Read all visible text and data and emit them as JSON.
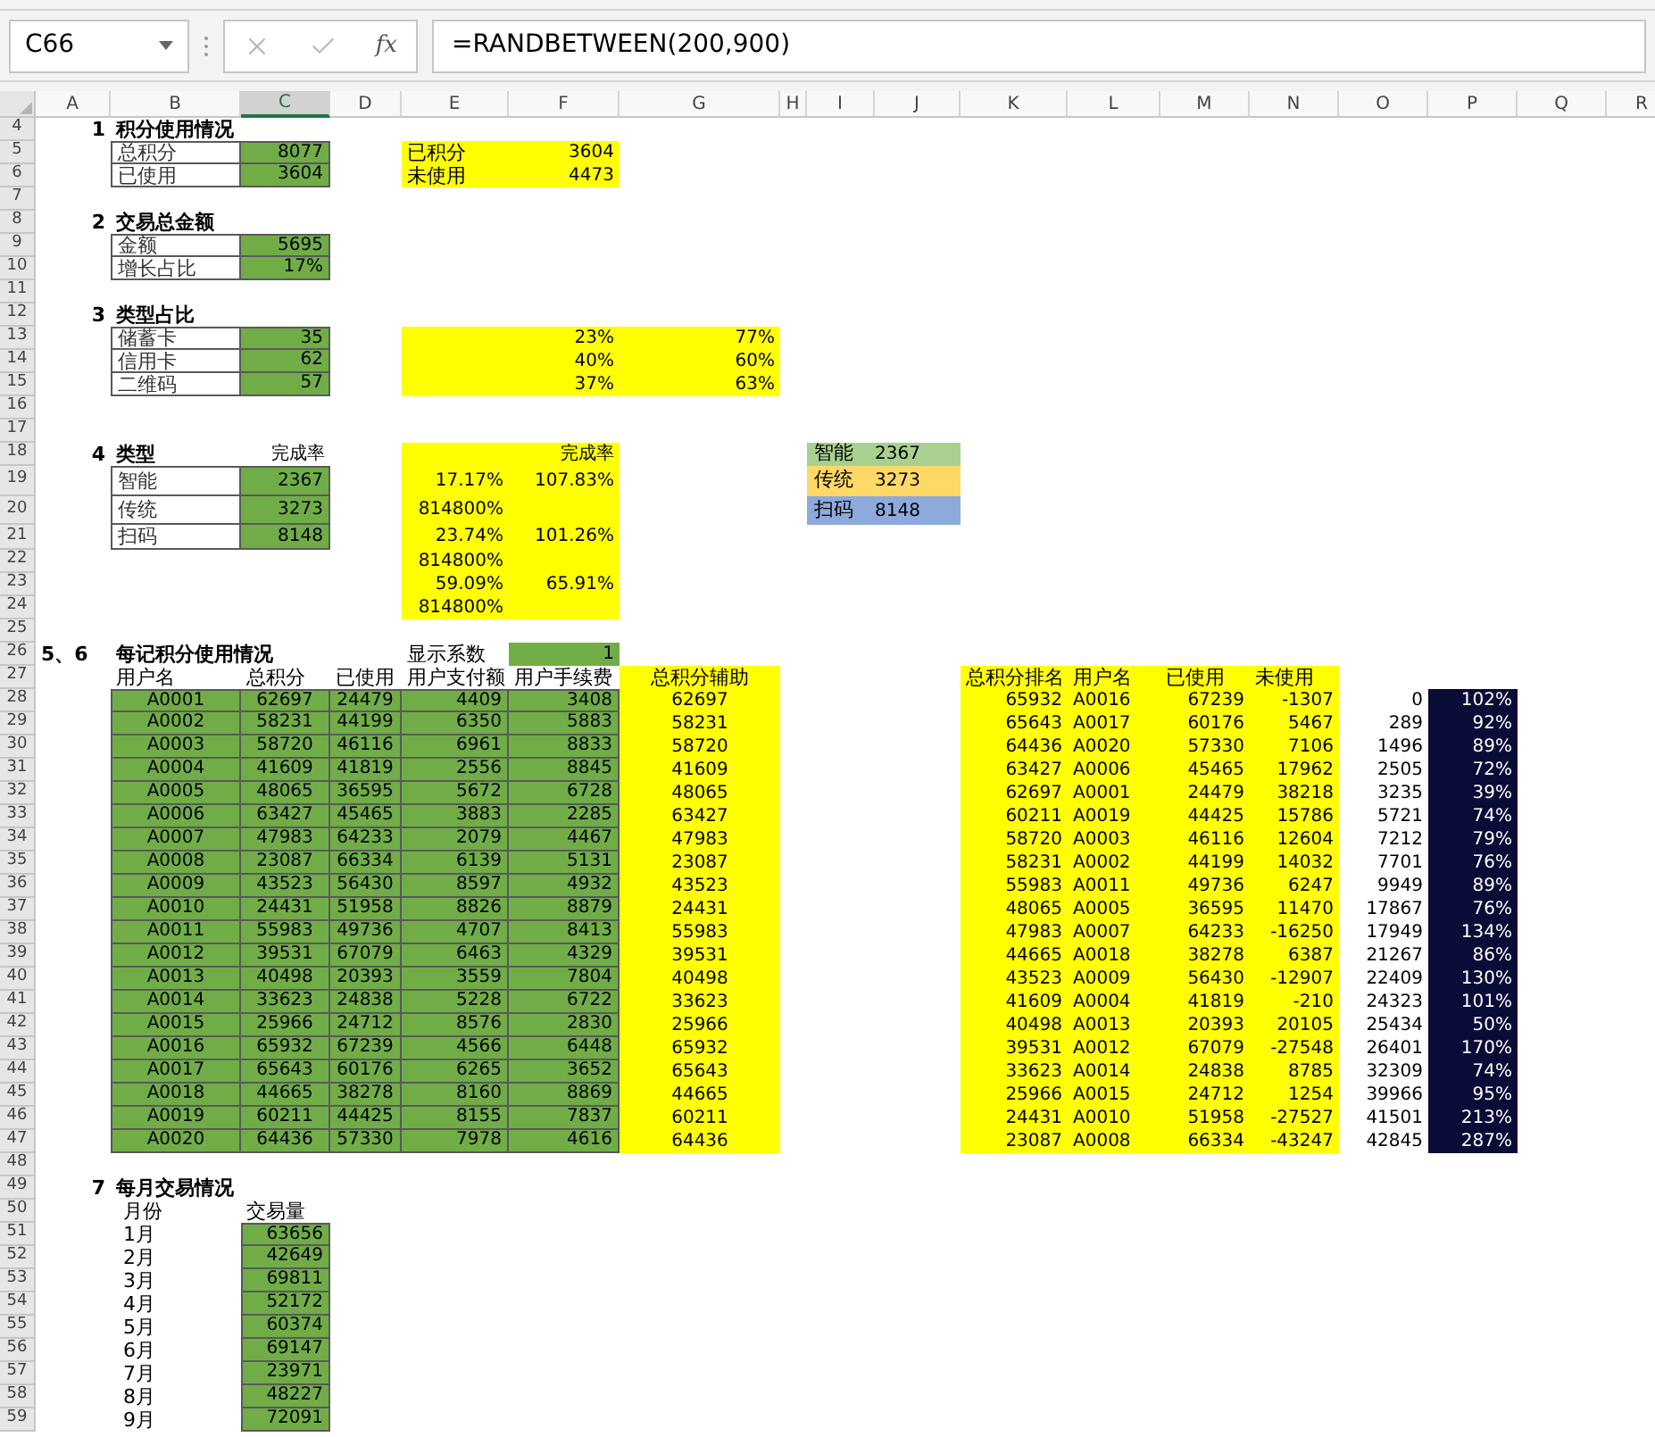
{
  "name_box": {
    "value": "C66"
  },
  "formula_bar": {
    "function_label": "fx",
    "formula": "=RANDBETWEEN(200,900)"
  },
  "columns": [
    {
      "label": "A",
      "selected": false
    },
    {
      "label": "B",
      "selected": false
    },
    {
      "label": "C",
      "selected": true
    },
    {
      "label": "D",
      "selected": false
    },
    {
      "label": "E",
      "selected": false
    },
    {
      "label": "F",
      "selected": false
    },
    {
      "label": "G",
      "selected": false
    },
    {
      "label": "H",
      "selected": false
    },
    {
      "label": "I",
      "selected": false
    },
    {
      "label": "J",
      "selected": false
    },
    {
      "label": "K",
      "selected": false
    },
    {
      "label": "L",
      "selected": false
    },
    {
      "label": "M",
      "selected": false
    },
    {
      "label": "N",
      "selected": false
    },
    {
      "label": "O",
      "selected": false
    },
    {
      "label": "P",
      "selected": false
    },
    {
      "label": "Q",
      "selected": false
    },
    {
      "label": "R",
      "selected": false
    }
  ],
  "rows": [
    "4",
    "5",
    "6",
    "7",
    "8",
    "9",
    "10",
    "11",
    "12",
    "13",
    "14",
    "15",
    "16",
    "17",
    "18",
    "19",
    "20",
    "21",
    "22",
    "23",
    "24",
    "25",
    "26",
    "27",
    "28",
    "29",
    "30",
    "31",
    "32",
    "33",
    "34",
    "35",
    "36",
    "37",
    "38",
    "39",
    "40",
    "41",
    "42",
    "43",
    "44",
    "45",
    "46",
    "47",
    "48",
    "49",
    "50",
    "51",
    "52",
    "53",
    "54",
    "55",
    "56",
    "57",
    "58",
    "59"
  ],
  "usage": {
    "number": "1",
    "title": "积分使用情况",
    "table": [
      {
        "label": "总积分",
        "value": "8077"
      },
      {
        "label": "已使用",
        "value": "3604"
      }
    ],
    "summary": [
      {
        "label": "已积分",
        "value": "3604"
      },
      {
        "label": "未使用",
        "value": "4473"
      }
    ]
  },
  "transactions": {
    "number": "2",
    "title": "交易总金额",
    "table": [
      {
        "label": "金额",
        "value": "5695"
      },
      {
        "label": "增长占比",
        "value": "17%"
      }
    ]
  },
  "type_share": {
    "number": "3",
    "title": "类型占比",
    "table": [
      {
        "label": "储蓄卡",
        "value": "35"
      },
      {
        "label": "信用卡",
        "value": "62"
      },
      {
        "label": "二维码",
        "value": "57"
      }
    ],
    "summary": [
      {
        "share": "23%",
        "rest": "77%"
      },
      {
        "share": "40%",
        "rest": "60%"
      },
      {
        "share": "37%",
        "rest": "63%"
      }
    ]
  },
  "type_completion": {
    "number": "4",
    "title": "类型",
    "value_header": "完成率",
    "table": [
      {
        "label": "智能",
        "value": "2367"
      },
      {
        "label": "传统",
        "value": "3273"
      },
      {
        "label": "扫码",
        "value": "8148"
      }
    ],
    "summary_header": "完成率",
    "summary": [
      {
        "share": "17.17%",
        "rate": "107.83%"
      },
      {
        "share": "814800%"
      },
      {
        "share": "23.74%",
        "rate": "101.26%"
      },
      {
        "share": "814800%"
      },
      {
        "share": "59.09%",
        "rate": "65.91%"
      },
      {
        "share": "814800%"
      }
    ],
    "legend": [
      {
        "label": "智能",
        "value": "2367",
        "color": "#a9d08e"
      },
      {
        "label": "传统",
        "value": "3273",
        "color": "#ffd966"
      },
      {
        "label": "扫码",
        "value": "8148",
        "color": "#8ea9db"
      }
    ]
  },
  "per_user": {
    "number": "5、6",
    "title": "每记积分使用情况",
    "coefficient_label": "显示系数",
    "coefficient": "1",
    "columns": [
      "用户名",
      "总积分",
      "已使用",
      "用户支付额",
      "用户手续费",
      "总积分辅助"
    ],
    "rows": [
      [
        "A0001",
        "62697",
        "24479",
        "4409",
        "3408",
        "62697"
      ],
      [
        "A0002",
        "58231",
        "44199",
        "6350",
        "5883",
        "58231"
      ],
      [
        "A0003",
        "58720",
        "46116",
        "6961",
        "8833",
        "58720"
      ],
      [
        "A0004",
        "41609",
        "41819",
        "2556",
        "8845",
        "41609"
      ],
      [
        "A0005",
        "48065",
        "36595",
        "5672",
        "6728",
        "48065"
      ],
      [
        "A0006",
        "63427",
        "45465",
        "3883",
        "2285",
        "63427"
      ],
      [
        "A0007",
        "47983",
        "64233",
        "2079",
        "4467",
        "47983"
      ],
      [
        "A0008",
        "23087",
        "66334",
        "6139",
        "5131",
        "23087"
      ],
      [
        "A0009",
        "43523",
        "56430",
        "8597",
        "4932",
        "43523"
      ],
      [
        "A0010",
        "24431",
        "51958",
        "8826",
        "8879",
        "24431"
      ],
      [
        "A0011",
        "55983",
        "49736",
        "4707",
        "8413",
        "55983"
      ],
      [
        "A0012",
        "39531",
        "67079",
        "6463",
        "4329",
        "39531"
      ],
      [
        "A0013",
        "40498",
        "20393",
        "3559",
        "7804",
        "40498"
      ],
      [
        "A0014",
        "33623",
        "24838",
        "5228",
        "6722",
        "33623"
      ],
      [
        "A0015",
        "25966",
        "24712",
        "8576",
        "2830",
        "25966"
      ],
      [
        "A0016",
        "65932",
        "67239",
        "4566",
        "6448",
        "65932"
      ],
      [
        "A0017",
        "65643",
        "60176",
        "6265",
        "3652",
        "65643"
      ],
      [
        "A0018",
        "44665",
        "38278",
        "8160",
        "8869",
        "44665"
      ],
      [
        "A0019",
        "60211",
        "44425",
        "8155",
        "7837",
        "60211"
      ],
      [
        "A0020",
        "64436",
        "57330",
        "7978",
        "4616",
        "64436"
      ]
    ]
  },
  "ranking": {
    "columns": [
      "总积分排名",
      "用户名",
      "已使用",
      "未使用"
    ],
    "rows": [
      [
        "65932",
        "A0016",
        "67239",
        "-1307",
        "0",
        "102%"
      ],
      [
        "65643",
        "A0017",
        "60176",
        "5467",
        "289",
        "92%"
      ],
      [
        "64436",
        "A0020",
        "57330",
        "7106",
        "1496",
        "89%"
      ],
      [
        "63427",
        "A0006",
        "45465",
        "17962",
        "2505",
        "72%"
      ],
      [
        "62697",
        "A0001",
        "24479",
        "38218",
        "3235",
        "39%"
      ],
      [
        "60211",
        "A0019",
        "44425",
        "15786",
        "5721",
        "74%"
      ],
      [
        "58720",
        "A0003",
        "46116",
        "12604",
        "7212",
        "79%"
      ],
      [
        "58231",
        "A0002",
        "44199",
        "14032",
        "7701",
        "76%"
      ],
      [
        "55983",
        "A0011",
        "49736",
        "6247",
        "9949",
        "89%"
      ],
      [
        "48065",
        "A0005",
        "36595",
        "11470",
        "17867",
        "76%"
      ],
      [
        "47983",
        "A0007",
        "64233",
        "-16250",
        "17949",
        "134%"
      ],
      [
        "44665",
        "A0018",
        "38278",
        "6387",
        "21267",
        "86%"
      ],
      [
        "43523",
        "A0009",
        "56430",
        "-12907",
        "22409",
        "130%"
      ],
      [
        "41609",
        "A0004",
        "41819",
        "-210",
        "24323",
        "101%"
      ],
      [
        "40498",
        "A0013",
        "20393",
        "20105",
        "25434",
        "50%"
      ],
      [
        "39531",
        "A0012",
        "67079",
        "-27548",
        "26401",
        "170%"
      ],
      [
        "33623",
        "A0014",
        "24838",
        "8785",
        "32309",
        "74%"
      ],
      [
        "25966",
        "A0015",
        "24712",
        "1254",
        "39966",
        "95%"
      ],
      [
        "24431",
        "A0010",
        "51958",
        "-27527",
        "41501",
        "213%"
      ],
      [
        "23087",
        "A0008",
        "66334",
        "-43247",
        "42845",
        "287%"
      ]
    ]
  },
  "monthly": {
    "number": "7",
    "title": "每月交易情况",
    "columns": [
      "月份",
      "交易量"
    ],
    "rows": [
      [
        "1月",
        "63656"
      ],
      [
        "2月",
        "42649"
      ],
      [
        "3月",
        "69811"
      ],
      [
        "4月",
        "52172"
      ],
      [
        "5月",
        "60374"
      ],
      [
        "6月",
        "69147"
      ],
      [
        "7月",
        "23971"
      ],
      [
        "8月",
        "48227"
      ],
      [
        "9月",
        "72091"
      ]
    ]
  }
}
